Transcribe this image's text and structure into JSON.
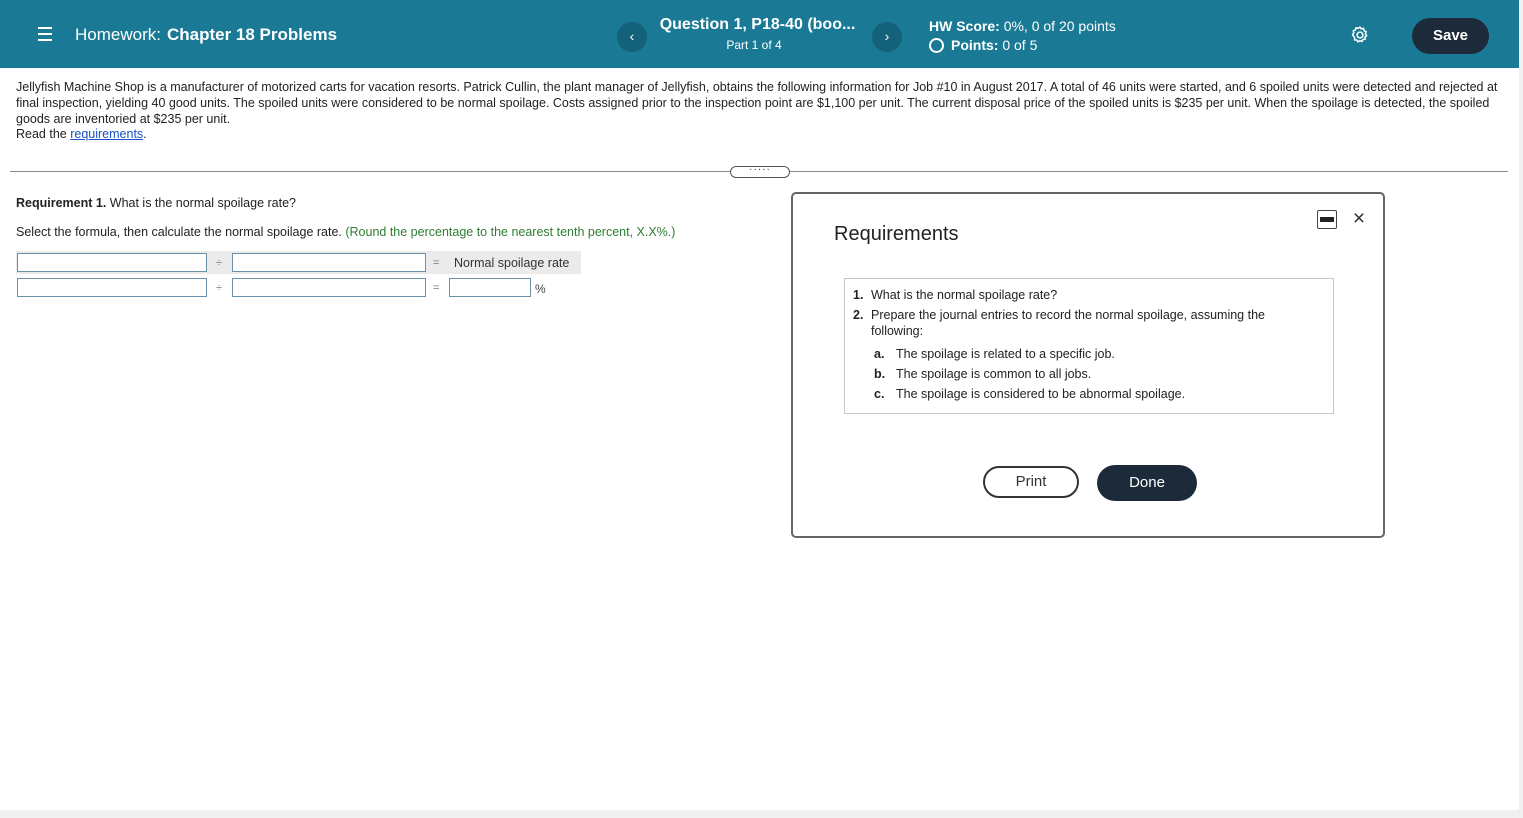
{
  "header": {
    "menu_icon": "hamburger-menu-icon",
    "hw_label": "Homework:",
    "hw_name": "Chapter 18 Problems",
    "prev_label": "‹",
    "next_label": "›",
    "question_title": "Question 1, P18-40 (boo...",
    "question_part": "Part 1 of 4",
    "score_label": "HW Score:",
    "score_value": "0%, 0 of 20 points",
    "points_label": "Points:",
    "points_value": "0 of 5",
    "save_label": "Save",
    "settings_icon": "gear-icon",
    "bar_color": "#1a7a95"
  },
  "problem": {
    "text": "Jellyfish Machine Shop is a manufacturer of motorized carts for vacation resorts. Patrick Cullin, the plant manager of Jellyfish, obtains the following information for Job #10 in August 2017. A total of 46 units were started, and 6 spoiled units were detected and rejected at final inspection, yielding 40 good units. The spoiled units were considered to be normal spoilage. Costs assigned prior to the inspection point are $1,100 per unit. The current disposal price of the spoiled units is $235 per unit. When the spoilage is detected, the spoiled goods are inventoried at $235 per unit.",
    "read_prefix": "Read the ",
    "read_link": "requirements",
    "read_suffix": "."
  },
  "divider": {
    "handle_dots": "·····"
  },
  "requirement1": {
    "label": "Requirement 1.",
    "question": " What is the normal spoilage rate?",
    "instruction": "Select the formula, then calculate the normal spoilage rate. ",
    "hint": "(Round the percentage to the nearest tenth percent, X.X%.)",
    "divide_sign": "÷",
    "equals_sign": "=",
    "result_label": "Normal spoilage rate",
    "percent_sign": "%",
    "inputs": {
      "row1_numerator": "",
      "row1_denominator": "",
      "row2_numerator": "",
      "row2_denominator": "",
      "row2_result": ""
    }
  },
  "modal": {
    "title": "Requirements",
    "minimize_icon": "minimize-icon",
    "close_icon": "×",
    "items": [
      {
        "num": "1.",
        "text": "What is the normal spoilage rate?"
      },
      {
        "num": "2.",
        "text": "Prepare the journal entries to record the normal spoilage, assuming the following:"
      }
    ],
    "subitems": [
      {
        "letter": "a.",
        "text": "The spoilage is related to a specific job."
      },
      {
        "letter": "b.",
        "text": "The spoilage is common to all jobs."
      },
      {
        "letter": "c.",
        "text": "The spoilage is considered to be abnormal spoilage."
      }
    ],
    "print_label": "Print",
    "done_label": "Done"
  }
}
